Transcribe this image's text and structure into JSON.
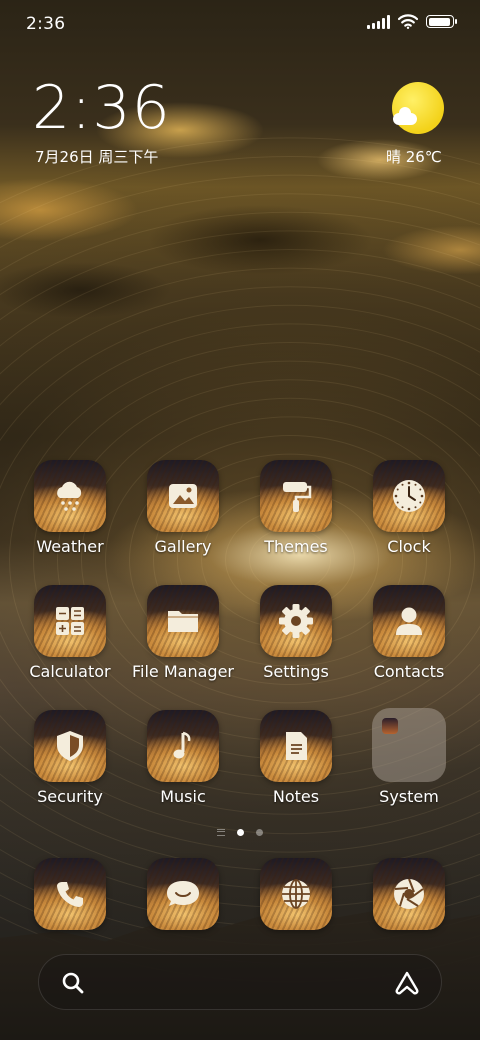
{
  "status_bar": {
    "time": "2:36",
    "icons": [
      "signal-icon",
      "wifi-icon",
      "battery-icon"
    ],
    "battery_level": 0.95
  },
  "clock_widget": {
    "time": "2:36",
    "date": "7月26日 周三下午"
  },
  "weather_widget": {
    "icon": "sun-cloud-icon",
    "text": "晴 26℃"
  },
  "apps": [
    {
      "label": "Weather",
      "icon": "weather-icon"
    },
    {
      "label": "Gallery",
      "icon": "gallery-icon"
    },
    {
      "label": "Themes",
      "icon": "themes-icon"
    },
    {
      "label": "Clock",
      "icon": "clock-icon"
    },
    {
      "label": "Calculator",
      "icon": "calculator-icon"
    },
    {
      "label": "File Manager",
      "icon": "folder-icon"
    },
    {
      "label": "Settings",
      "icon": "gear-icon"
    },
    {
      "label": "Contacts",
      "icon": "person-icon"
    },
    {
      "label": "Security",
      "icon": "shield-icon"
    },
    {
      "label": "Music",
      "icon": "music-note-icon"
    },
    {
      "label": "Notes",
      "icon": "note-icon"
    },
    {
      "label": "System",
      "icon": "folder-group-icon"
    }
  ],
  "pager": {
    "pages": 2,
    "active": 1,
    "icons": [
      "page-list-icon"
    ]
  },
  "dock": [
    {
      "icon": "phone-icon"
    },
    {
      "icon": "message-icon"
    },
    {
      "icon": "browser-globe-icon"
    },
    {
      "icon": "camera-aperture-icon"
    }
  ],
  "search_bar": {
    "icons": [
      "search-icon",
      "assistant-icon"
    ]
  },
  "colors": {
    "accent_sun": "#f3d21a",
    "text": "#ffffff",
    "icon_glyph": "#f4eddc"
  }
}
